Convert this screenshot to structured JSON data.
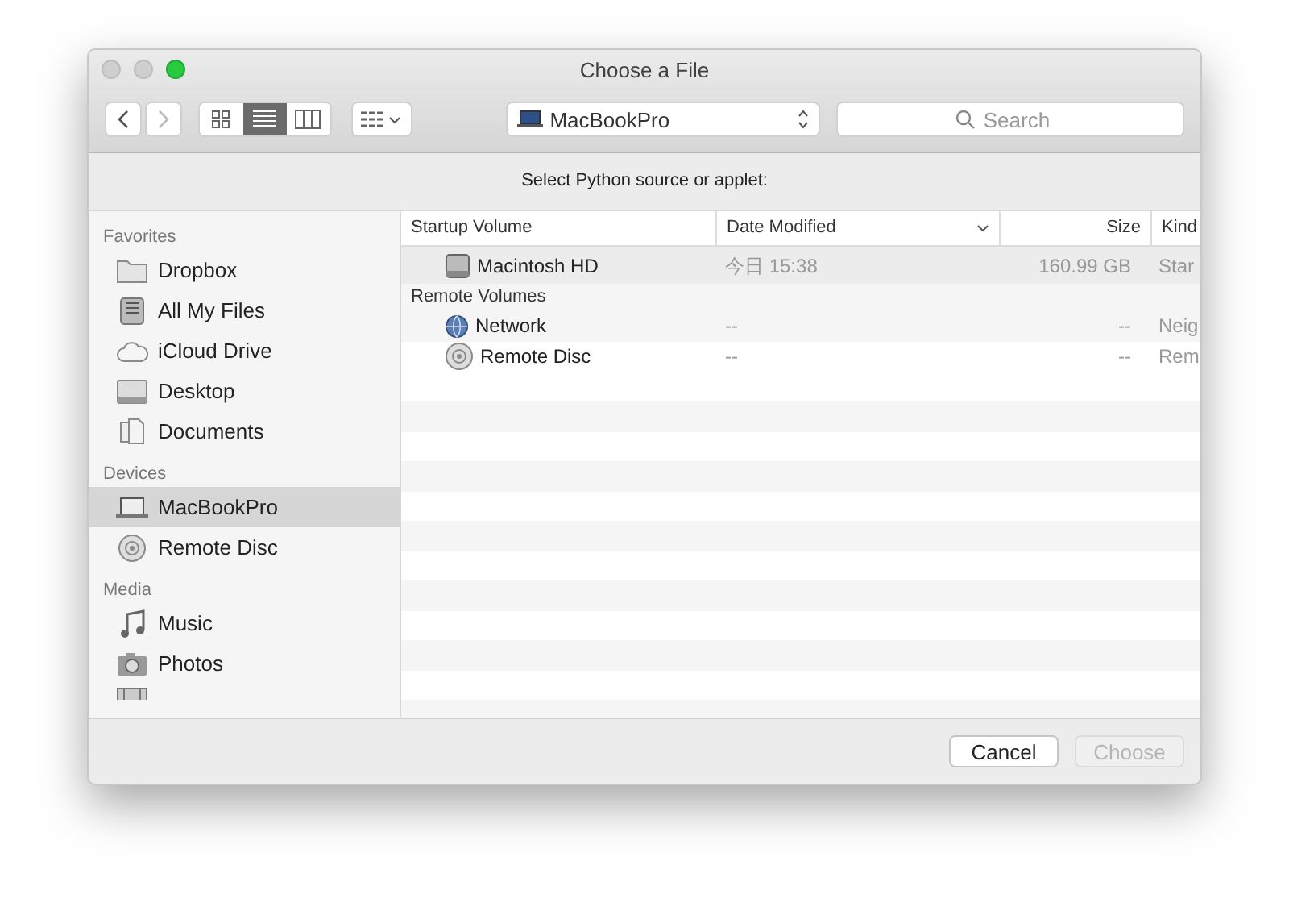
{
  "window": {
    "title": "Choose a File"
  },
  "toolbar": {
    "views": [
      {
        "kind": "icons",
        "selected": false
      },
      {
        "kind": "list",
        "selected": true
      },
      {
        "kind": "columns",
        "selected": false
      }
    ],
    "location": "MacBookPro",
    "search": {
      "placeholder": "Search"
    }
  },
  "prompt": "Select Python source or applet:",
  "sidebar": {
    "sections": [
      {
        "title": "Favorites",
        "items": [
          {
            "label": "Dropbox",
            "selected": false
          },
          {
            "label": "All My Files",
            "selected": false
          },
          {
            "label": "iCloud Drive",
            "selected": false
          },
          {
            "label": "Desktop",
            "selected": false
          },
          {
            "label": "Documents",
            "selected": false
          }
        ]
      },
      {
        "title": "Devices",
        "items": [
          {
            "label": "MacBookPro",
            "selected": true
          },
          {
            "label": "Remote Disc",
            "selected": false
          }
        ]
      },
      {
        "title": "Media",
        "items": [
          {
            "label": "Music",
            "selected": false
          },
          {
            "label": "Photos",
            "selected": false
          }
        ]
      }
    ]
  },
  "table": {
    "columns": [
      "Startup Volume",
      "Date Modified",
      "Size",
      "Kind"
    ],
    "groups": [
      {
        "rows": [
          {
            "name": "Macintosh HD",
            "date": "今日 15:38",
            "size": "160.99 GB",
            "kind": "Star"
          }
        ]
      },
      {
        "title": "Remote Volumes",
        "rows": [
          {
            "name": "Network",
            "date": "--",
            "size": "--",
            "kind": "Neig"
          },
          {
            "name": "Remote Disc",
            "date": "--",
            "size": "--",
            "kind": "Rem"
          }
        ]
      }
    ]
  },
  "buttons": [
    {
      "label": "Cancel",
      "disabled": false
    },
    {
      "label": "Choose",
      "disabled": true
    }
  ]
}
